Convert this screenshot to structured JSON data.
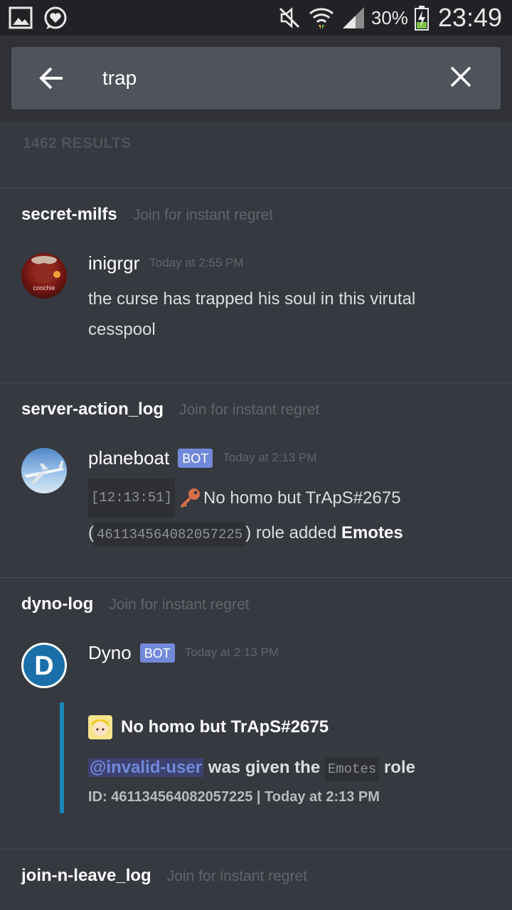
{
  "status_bar": {
    "battery": "30%",
    "time": "23:49"
  },
  "search": {
    "query": "trap",
    "results_count": "1462 RESULTS"
  },
  "results": [
    {
      "channel": "secret-milfs",
      "channel_desc": "Join for instant regret",
      "author": "inigrgr",
      "timestamp": "Today at 2:55 PM",
      "text_line1": "the curse has trapped his soul in this virutal",
      "text_line2": "cesspool",
      "avatar_text": "coochie"
    },
    {
      "channel": "server-action_log",
      "channel_desc": "Join for instant regret",
      "author": "planeboat",
      "bot_tag": "BOT",
      "timestamp": "Today at 2:13 PM",
      "log_time": "[12:13:51]",
      "log_user": "No homo but TrApS#2675",
      "log_id": "461134564082057225",
      "log_action": "role added",
      "log_role": "Emotes"
    },
    {
      "channel": "dyno-log",
      "channel_desc": "Join for instant regret",
      "author": "Dyno",
      "bot_tag": "BOT",
      "timestamp": "Today at 2:13 PM",
      "avatar_letter": "D",
      "embed": {
        "author": "No homo but TrApS#2675",
        "mention": "@invalid-user",
        "text_before": "was given the",
        "role": "Emotes",
        "text_after": "role",
        "footer": "ID: 461134564082057225 | Today at 2:13 PM"
      }
    },
    {
      "channel": "join-n-leave_log",
      "channel_desc": "Join for instant regret"
    }
  ],
  "colors": {
    "background": "#36393f",
    "header": "#2f3136",
    "searchbox": "#4f545c",
    "bot_tag": "#7289da",
    "embed_border": "#1c85b8"
  }
}
